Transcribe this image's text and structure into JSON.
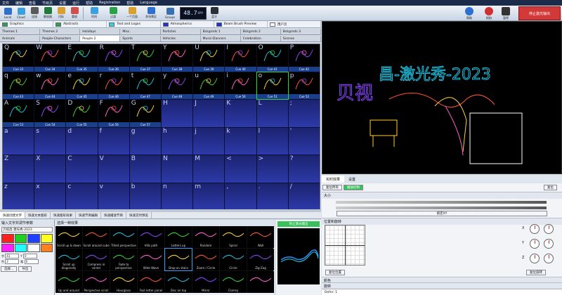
{
  "menu": [
    "文件",
    "编辑",
    "查看",
    "节目页",
    "设置",
    "运行",
    "帮助",
    "Registration",
    "帮助",
    "Language"
  ],
  "toolbar": {
    "left": [
      "Local",
      "Cloud",
      "连接",
      "解放器",
      "闪烁",
      "重放"
    ],
    "mid": [
      "时间",
      "过渡",
      "一个页面",
      "多场景区",
      "Groups"
    ],
    "lcd": "48.7",
    "lcd_unit": "BPM",
    "transport": "蓝牙",
    "right": [
      "帮助",
      "抓拍",
      "暂停"
    ],
    "stop_all": "停止激光输出"
  },
  "categories": [
    {
      "label": "Graphics",
      "color": "#2aa14a"
    },
    {
      "label": "Abstracts",
      "color": "#2aa14a"
    },
    {
      "label": "Text and Logos",
      "color": "#2fd6d6"
    },
    {
      "label": "Atmospherics",
      "color": "#2233cc"
    },
    {
      "label": "Beam Brush Preview",
      "color": "#2233cc"
    },
    {
      "label": "用户页",
      "color": "#ffffff"
    }
  ],
  "tabs_row1": [
    "Themes 1",
    "Themes 2",
    "Holidays",
    "Misc.",
    "Particles",
    "Bckgrnds 1",
    "Bckgrnds 2",
    "Bckgrnds 3"
  ],
  "tabs_row2": [
    "Animals",
    "People-Characters",
    "People 2",
    "Sports",
    "Vehicles",
    "Music-Dancers",
    "Celebration",
    "Scenes"
  ],
  "active_tab2": 2,
  "grid_keys": [
    "Q",
    "W",
    "E",
    "R",
    "T",
    "Y",
    "U",
    "I",
    "O",
    "P",
    "q",
    "w",
    "e",
    "r",
    "t",
    "y",
    "u",
    "i",
    "o",
    "p",
    "A",
    "S",
    "D",
    "F",
    "G",
    "H",
    "J",
    "K",
    "L",
    ";",
    "a",
    "s",
    "d",
    "f",
    "g",
    "h",
    "j",
    "k",
    "l",
    "'",
    "Z",
    "X",
    "C",
    "V",
    "B",
    "N",
    "M",
    "<",
    ">",
    "?",
    "z",
    "x",
    "c",
    "v",
    "b",
    "n",
    "m",
    ",",
    ".",
    "/"
  ],
  "filled_cues": {
    "0": "Cue 33",
    "1": "Cue 34",
    "2": "Cue 35",
    "3": "Cue 36",
    "4": "Cue 37",
    "5": "Cue 38",
    "6": "Cue 39",
    "7": "Cue 40",
    "8": "Cue 41",
    "9": "Cue 42",
    "10": "Cue 43",
    "11": "Cue 44",
    "12": "Cue 45",
    "13": "Cue 46",
    "14": "Cue 47",
    "15": "Cue 48",
    "16": "Cue 49",
    "17": "Cue 50",
    "18": "Cue 51",
    "19": "Cue 52",
    "20": "Cue 53",
    "21": "Cue 54",
    "22": "Cue 55",
    "23": "Cue 56",
    "24": "Cue 57"
  },
  "selected_cue": 18,
  "bottom_tabs": [
    "快速创建文字",
    "快速文本图形",
    "快速图形效果",
    "快速节目编辑",
    "快速播放节目",
    "快速实时预览"
  ],
  "text_panel": {
    "title": "输入文字并调节参数",
    "input": "贝视昌-激光秀-2023",
    "labels": [
      "字",
      "Y",
      "色",
      "粗"
    ],
    "values": [
      "41",
      "0",
      "2",
      "0"
    ],
    "button1": "选择...",
    "button2": "导出"
  },
  "effect_panel": {
    "title": "选择一种效果",
    "effects": [
      "Scroll up & down",
      "Scroll around cube",
      "Tilted perspective",
      "Hills path",
      "Letters up",
      "Random",
      "Spiral",
      "Wall",
      "Scroll up diagonally",
      "Compress in center",
      "Fade to perspective",
      "Wide Wave",
      "Drop on stairs",
      "Zoom / Circle",
      "Circle",
      "Zig-Zag",
      "Up and around",
      "Perspective scroll",
      "Hourglass",
      "Fast letter panel",
      "Disc on top",
      "Mirror",
      "Clumsy",
      ""
    ],
    "selected": 12
  },
  "preview_panel": {
    "button": "停止激光输出"
  },
  "right_tabs": [
    "实时效果",
    "设置"
  ],
  "right_tools": [
    "复位所有",
    "播放控制"
  ],
  "right_reset": "复位",
  "sections": [
    "大小",
    "位置和旋转",
    "颜色",
    "旋转"
  ],
  "slider_label": "锁定XY",
  "axis_labels": [
    "X",
    "Y",
    "Z"
  ],
  "btn_reset_pos": "复位位置",
  "btn_reset_rot": "复位旋转",
  "status": "Defer: 1",
  "preview_text": [
    "贝视",
    "昌-激光秀-2023"
  ]
}
